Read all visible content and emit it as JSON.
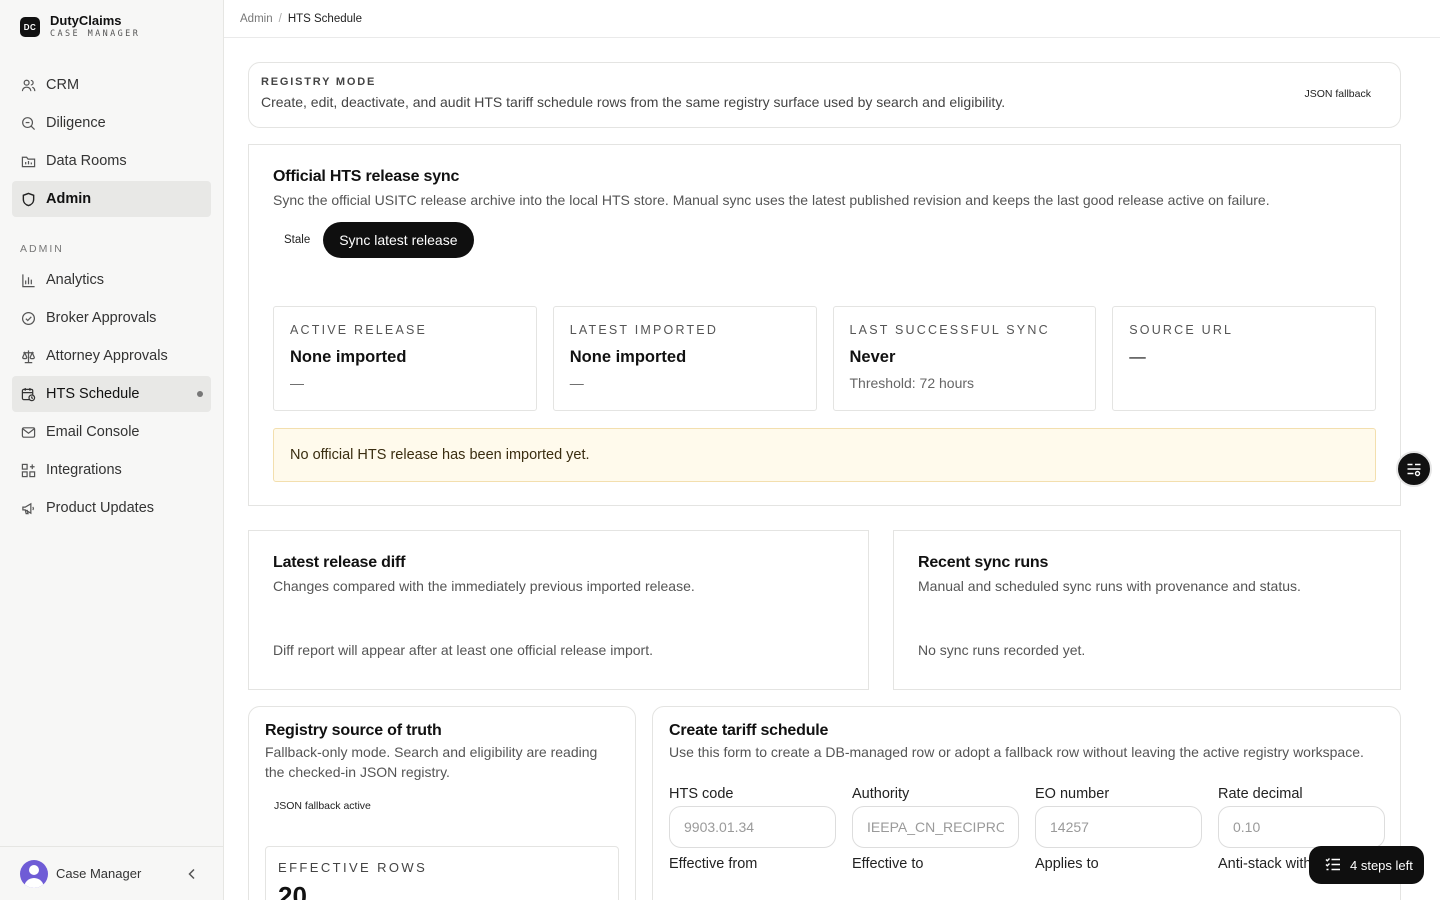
{
  "brand": {
    "logo": "DC",
    "name": "DutyClaims",
    "subtitle": "CASE MANAGER"
  },
  "nav_main": [
    {
      "label": "CRM",
      "icon": "users-icon"
    },
    {
      "label": "Diligence",
      "icon": "search-doc-icon"
    },
    {
      "label": "Data Rooms",
      "icon": "folder-icon"
    },
    {
      "label": "Admin",
      "icon": "shield-icon",
      "active": true
    }
  ],
  "admin_section_label": "ADMIN",
  "nav_admin": [
    {
      "label": "Analytics",
      "icon": "bar-chart-icon"
    },
    {
      "label": "Broker Approvals",
      "icon": "check-circle-icon"
    },
    {
      "label": "Attorney Approvals",
      "icon": "scale-icon"
    },
    {
      "label": "HTS Schedule",
      "icon": "calendar-clock-icon",
      "current": true
    },
    {
      "label": "Email Console",
      "icon": "mail-icon"
    },
    {
      "label": "Integrations",
      "icon": "grid-icon"
    },
    {
      "label": "Product Updates",
      "icon": "megaphone-icon"
    }
  ],
  "footer": {
    "user_name": "Case Manager"
  },
  "breadcrumb": {
    "parent": "Admin",
    "separator": "/",
    "current": "HTS Schedule"
  },
  "registry_mode": {
    "label": "REGISTRY MODE",
    "description": "Create, edit, deactivate, and audit HTS tariff schedule rows from the same registry surface used by search and eligibility.",
    "chip": "JSON fallback"
  },
  "sync": {
    "title": "Official HTS release sync",
    "description": "Sync the official USITC release archive into the local HTS store. Manual sync uses the latest published revision and keeps the last good release active on failure.",
    "status_chip": "Stale",
    "sync_button": "Sync latest release",
    "stats": [
      {
        "label": "ACTIVE RELEASE",
        "value": "None imported",
        "sub": "—"
      },
      {
        "label": "LATEST IMPORTED",
        "value": "None imported",
        "sub": "—"
      },
      {
        "label": "LAST SUCCESSFUL SYNC",
        "value": "Never",
        "sub": "Threshold: 72 hours"
      },
      {
        "label": "SOURCE URL",
        "value": "—",
        "sub": ""
      }
    ],
    "notice": "No official HTS release has been imported yet."
  },
  "diff": {
    "title": "Latest release diff",
    "description": "Changes compared with the immediately previous imported release.",
    "empty": "Diff report will appear after at least one official release import."
  },
  "runs": {
    "title": "Recent sync runs",
    "description": "Manual and scheduled sync runs with provenance and status.",
    "empty": "No sync runs recorded yet."
  },
  "source": {
    "title": "Registry source of truth",
    "description": "Fallback-only mode. Search and eligibility are reading the checked-in JSON registry.",
    "chip": "JSON fallback active",
    "effective_rows_label": "EFFECTIVE ROWS",
    "effective_rows_value": "20"
  },
  "create": {
    "title": "Create tariff schedule",
    "description": "Use this form to create a DB-managed row or adopt a fallback row without leaving the active registry workspace.",
    "fields": [
      {
        "label": "HTS code",
        "placeholder": "9903.01.34"
      },
      {
        "label": "Authority",
        "placeholder": "IEEPA_CN_RECIPROCAL"
      },
      {
        "label": "EO number",
        "placeholder": "14257"
      },
      {
        "label": "Rate decimal",
        "placeholder": "0.10"
      }
    ],
    "fields_row2": [
      {
        "label": "Effective from"
      },
      {
        "label": "Effective to"
      },
      {
        "label": "Applies to"
      },
      {
        "label": "Anti-stack with"
      }
    ]
  },
  "steps_pill": "4 steps left"
}
